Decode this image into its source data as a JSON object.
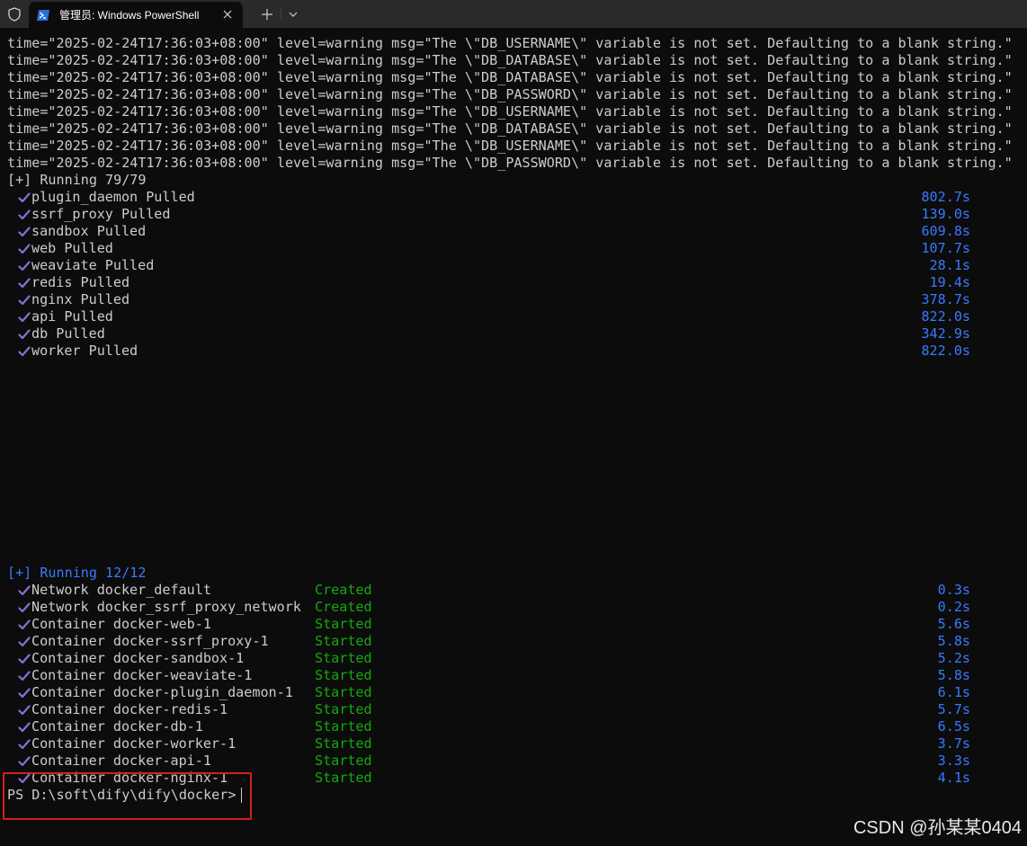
{
  "tab": {
    "title": "管理员: Windows PowerShell",
    "icons": {
      "shield": "shield-icon",
      "app": "powershell-icon",
      "close": "close-icon",
      "new": "plus-icon",
      "dropdown": "chevron-down-icon"
    }
  },
  "terminal": {
    "warnings": [
      "time=\"2025-02-24T17:36:03+08:00\" level=warning msg=\"The \\\"DB_USERNAME\\\" variable is not set. Defaulting to a blank string.\"",
      "time=\"2025-02-24T17:36:03+08:00\" level=warning msg=\"The \\\"DB_DATABASE\\\" variable is not set. Defaulting to a blank string.\"",
      "time=\"2025-02-24T17:36:03+08:00\" level=warning msg=\"The \\\"DB_DATABASE\\\" variable is not set. Defaulting to a blank string.\"",
      "time=\"2025-02-24T17:36:03+08:00\" level=warning msg=\"The \\\"DB_PASSWORD\\\" variable is not set. Defaulting to a blank string.\"",
      "time=\"2025-02-24T17:36:03+08:00\" level=warning msg=\"The \\\"DB_USERNAME\\\" variable is not set. Defaulting to a blank string.\"",
      "time=\"2025-02-24T17:36:03+08:00\" level=warning msg=\"The \\\"DB_DATABASE\\\" variable is not set. Defaulting to a blank string.\"",
      "time=\"2025-02-24T17:36:03+08:00\" level=warning msg=\"The \\\"DB_USERNAME\\\" variable is not set. Defaulting to a blank string.\"",
      "time=\"2025-02-24T17:36:03+08:00\" level=warning msg=\"The \\\"DB_PASSWORD\\\" variable is not set. Defaulting to a blank string.\""
    ],
    "pull_header": "[+] Running 79/79",
    "pulls": [
      {
        "label": "plugin_daemon Pulled",
        "time": "802.7s"
      },
      {
        "label": "ssrf_proxy Pulled",
        "time": "139.0s"
      },
      {
        "label": "sandbox Pulled",
        "time": "609.8s"
      },
      {
        "label": "web Pulled",
        "time": "107.7s"
      },
      {
        "label": "weaviate Pulled",
        "time": "28.1s"
      },
      {
        "label": "redis Pulled",
        "time": "19.4s"
      },
      {
        "label": "nginx Pulled",
        "time": "378.7s"
      },
      {
        "label": "api Pulled",
        "time": "822.0s"
      },
      {
        "label": "db Pulled",
        "time": "342.9s"
      },
      {
        "label": "worker Pulled",
        "time": "822.0s"
      }
    ],
    "run_header": "[+] Running 12/12",
    "runs": [
      {
        "label": "Network docker_default",
        "status": "Created",
        "time": "0.3s"
      },
      {
        "label": "Network docker_ssrf_proxy_network",
        "status": "Created",
        "time": "0.2s"
      },
      {
        "label": "Container docker-web-1",
        "status": "Started",
        "time": "5.6s"
      },
      {
        "label": "Container docker-ssrf_proxy-1",
        "status": "Started",
        "time": "5.8s"
      },
      {
        "label": "Container docker-sandbox-1",
        "status": "Started",
        "time": "5.2s"
      },
      {
        "label": "Container docker-weaviate-1",
        "status": "Started",
        "time": "5.8s"
      },
      {
        "label": "Container docker-plugin_daemon-1",
        "status": "Started",
        "time": "6.1s"
      },
      {
        "label": "Container docker-redis-1",
        "status": "Started",
        "time": "5.7s"
      },
      {
        "label": "Container docker-db-1",
        "status": "Started",
        "time": "6.5s"
      },
      {
        "label": "Container docker-worker-1",
        "status": "Started",
        "time": "3.7s"
      },
      {
        "label": "Container docker-api-1",
        "status": "Started",
        "time": "3.3s"
      },
      {
        "label": "Container docker-nginx-1",
        "status": "Started",
        "time": "4.1s"
      }
    ],
    "prompt": "PS D:\\soft\\dify\\dify\\docker> "
  },
  "watermark": "CSDN @孙某某0404",
  "colors": {
    "background": "#0c0c0c",
    "text": "#cccccc",
    "blue": "#3b78ff",
    "green": "#16c60c",
    "check": "#8a6fd6",
    "highlight": "#d42020"
  }
}
